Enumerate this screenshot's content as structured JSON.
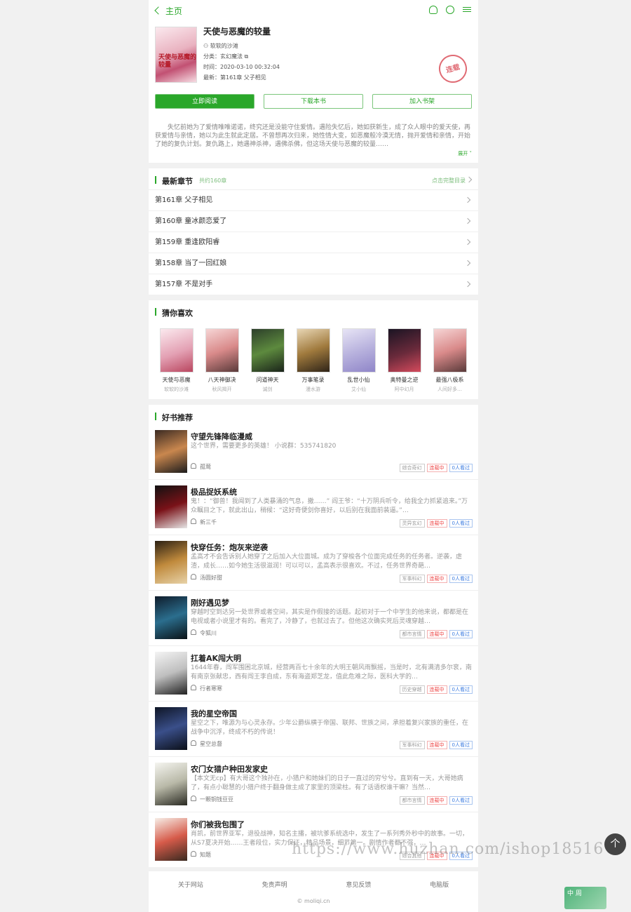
{
  "topbar": {
    "back_label": "主页"
  },
  "book": {
    "title": "天使与恶魔的较量",
    "cover_text": "天使与恶魔的较量",
    "author": "软软的沙滩",
    "category_label": "分类：",
    "category": "玄幻魔法",
    "time_label": "时间：",
    "time": "2020-03-10 00:32:04",
    "latest_label": "最新：",
    "latest": "第161章 父子相见",
    "status_stamp": "连载",
    "buttons": {
      "read": "立即阅读",
      "download": "下载本书",
      "shelf": "加入书架"
    },
    "intro": "失忆前她为了爱情唯唯诺诺，终究还是没能守住爱情。遇险失忆后，她如获新生，成了众人眼中的爱天使，再获爱情与亲情，她以为此生就此定居。不曾想再次归来，她性情大变，如恶魔般冷漠无情，抛开爱情和亲情，开始了她的复仇计划。复仇路上，她遇神杀神，遇佛杀佛，但这场天使与恶魔的较量……",
    "expand": "展开"
  },
  "latest_chapters": {
    "heading": "最新章节",
    "count": "共约160章",
    "view_all": "点击完整目录",
    "items": [
      "第161章 父子相见",
      "第160章 童冰颜恋爱了",
      "第159章 重逢欧阳睿",
      "第158章 当了一回红娘",
      "第157章 不是对手"
    ]
  },
  "guess": {
    "heading": "猜你喜欢",
    "items": [
      {
        "title": "天使与恶魔",
        "author": "软软的沙滩"
      },
      {
        "title": "八天神御决",
        "author": "秋风揭开"
      },
      {
        "title": "问道神天",
        "author": "诚剑"
      },
      {
        "title": "万事笔录",
        "author": "漫水游"
      },
      {
        "title": "乱世小仙",
        "author": "艾小仙"
      },
      {
        "title": "奥特曼之逆",
        "author": "阿中幻月"
      },
      {
        "title": "最强八极系",
        "author": "人间好多…"
      }
    ]
  },
  "recommend": {
    "heading": "好书推荐",
    "items": [
      {
        "title": "守望先锋降临漫威",
        "desc": "这个世界，需要更多的英雄！ 小说群：535741820",
        "author": "孤莺",
        "tags": [
          "综合奇幻",
          "连载中",
          "0人看过"
        ]
      },
      {
        "title": "极品捉妖系统",
        "desc": "鬼！：“御兽！我闻到了人类暴涌的气息，撒……” 阎王爷：“十万阴兵听令，给我全力抓紧追来。”万众瞩目之下，就此出山，稍候：“这好奇便剑你喜好，以后别在我面前装逼。”…",
        "author": "新三千",
        "tags": [
          "灵异玄幻",
          "连载中",
          "0人看过"
        ]
      },
      {
        "title": "快穿任务：炮灰来逆袭",
        "desc": "孟高才不会告诉别人她穿了之后加入大位面城。成为了穿梭各个位面完成任务的任务者。逆袭，虐渣，成长……如今她生活很滋润！可以可以，孟高表示很喜欢。不过，任务世界奇葩…",
        "author": "汤圆好甜",
        "tags": [
          "军事科幻",
          "连载中",
          "0人看过"
        ]
      },
      {
        "title": "刚好遇见梦",
        "desc": "穿越时空到达另一处世界或者空间，其实是作假接的话题。起初对于一个中学生的他来说，都都是在电视或者小说里才有的。看完了，冷静了，也就过去了。但他这次确实死后灵魂穿越…",
        "author": "令狐川",
        "tags": [
          "都市言情",
          "连载中",
          "0人看过"
        ]
      },
      {
        "title": "扛着AK闯大明",
        "desc": "1644年春，闯军围困北京城，经营两百七十余年的大明王朝风雨飘摇，当是时，北有满清多尔衮，南有南京张献忠，西有闯王李自成，东有海盗郑芝龙，值此危难之际，医科大学的…",
        "author": "行者寒寒",
        "tags": [
          "历史穿越",
          "连载中",
          "0人看过"
        ]
      },
      {
        "title": "我的星空帝国",
        "desc": "星空之下，唯源为与心灵永存。少年公爵纵横于帝国、联邦、世族之间，承担着复兴家族的重任，在战争中沉浮，终成不朽的传说！",
        "author": "星空总督",
        "tags": [
          "军事科幻",
          "连载中",
          "0人看过"
        ]
      },
      {
        "title": "农门女猎户种田发家史",
        "desc": "【本文无cp】有大哥这个独孙在，小猎户和她妹们的日子一直过的穷兮兮。直到有一天，大哥她病了，有点小聪慧的小猎户终于翻身做主成了家里的顶梁柱。有了话语权谁干嘛？当然…",
        "author": "一颗铜钱豆豆",
        "tags": [
          "都市言情",
          "连载中",
          "0人看过"
        ]
      },
      {
        "title": "你们被我包围了",
        "desc": "肖凯，前世界亚军，退役战神，知名主播，被坑爹系统选中，发生了一系列秀外秒中的故事。一切，从S7夏决开始……王者段位，实力保证，精品场景，细节第一。剧情作者都不强，…",
        "author": "知题",
        "tags": [
          "综合其他",
          "连载中",
          "0人看过"
        ]
      }
    ]
  },
  "footer": {
    "links": [
      "关于网站",
      "免责声明",
      "意见反馈",
      "电脑版"
    ],
    "copyright": "© moliqi.cn"
  },
  "watermark": "https://www.huzhan.com/ishop18516",
  "overlay": {
    "to_top": "个",
    "mini_badge": "中 周"
  },
  "colors": {
    "accent": "#2aa72a",
    "status_red": "#e44444",
    "status_blue": "#3a7be0"
  }
}
